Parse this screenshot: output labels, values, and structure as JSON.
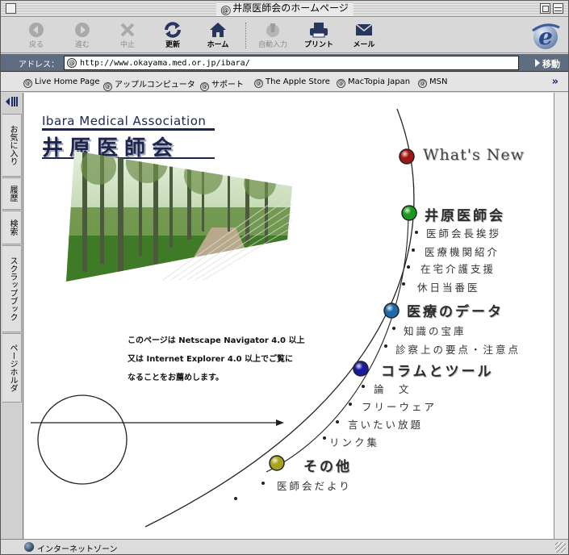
{
  "window": {
    "title": "井原医師会のホームページ"
  },
  "toolbar": {
    "buttons": [
      {
        "label": "戻る",
        "icon": "back-arrow-icon",
        "enabled": false
      },
      {
        "label": "進む",
        "icon": "forward-arrow-icon",
        "enabled": false
      },
      {
        "label": "中止",
        "icon": "stop-x-icon",
        "enabled": false
      },
      {
        "label": "更新",
        "icon": "refresh-icon",
        "enabled": true
      },
      {
        "label": "ホーム",
        "icon": "home-icon",
        "enabled": true
      },
      {
        "label": "自動入力",
        "icon": "autofill-icon",
        "enabled": false
      },
      {
        "label": "プリント",
        "icon": "printer-icon",
        "enabled": true
      },
      {
        "label": "メール",
        "icon": "mail-icon",
        "enabled": true
      }
    ]
  },
  "address": {
    "label": "アドレス：",
    "url": "http://www.okayama.med.or.jp/ibara/",
    "go_label": "移動"
  },
  "favorites": [
    "Live Home Page",
    "アップルコンピュータ",
    "サポート",
    "The Apple Store",
    "MacTopia Japan",
    "MSN"
  ],
  "explorer_tabs": [
    "お気に入り",
    "履歴",
    "検索",
    "スクラップブック",
    "ページホルダ"
  ],
  "status": {
    "zone": "インターネットゾーン"
  },
  "site": {
    "logo_en": "Ibara Medical Association",
    "logo_jp": "井原医師会",
    "notice": [
      "このページは Netscape Navigator 4.0 以上",
      "又は Internet Explorer 4.0 以上でご覧に",
      "なることをお薦めします。"
    ],
    "nav": {
      "whats_new": "What's New",
      "sections": [
        {
          "title": "井原医師会",
          "color": "#1a9a1a",
          "items": [
            "医師会長挨拶",
            "医療機関紹介",
            "在宅介護支援",
            "休日当番医"
          ]
        },
        {
          "title": "医療のデータ",
          "color": "#1f6aa8",
          "items": [
            "知識の宝庫",
            "診察上の要点・注意点"
          ]
        },
        {
          "title": "コラムとツール",
          "color": "#1a1a9e",
          "items": [
            "論　文",
            "フリーウェア",
            "言いたい放題",
            "リンク集"
          ]
        },
        {
          "title": "その他",
          "color": "#a8a21a",
          "items": [
            "医師会だより"
          ]
        }
      ],
      "whats_new_color": "#a01616"
    }
  }
}
